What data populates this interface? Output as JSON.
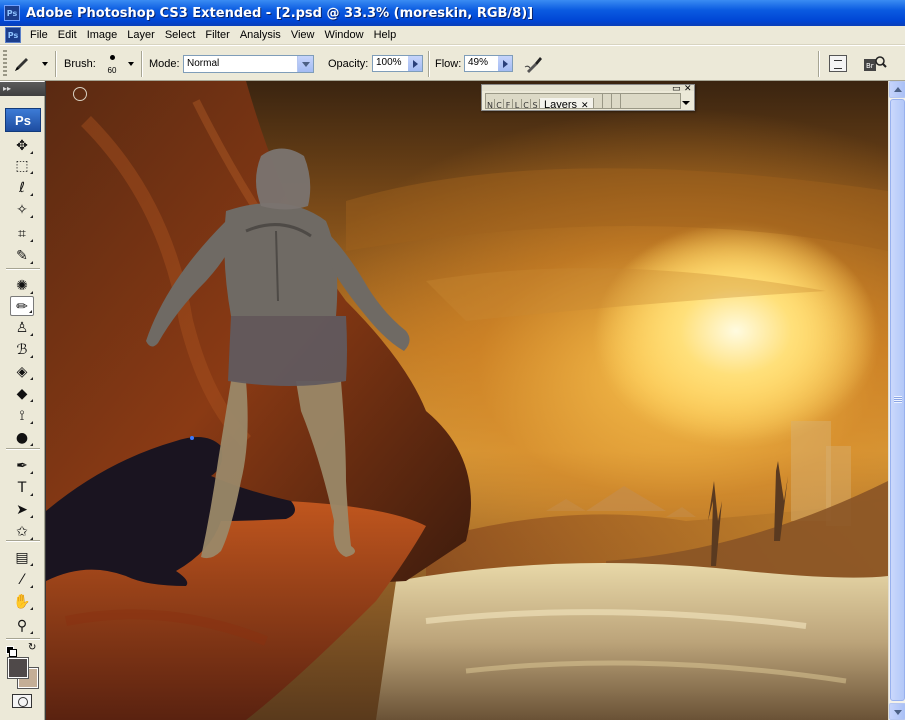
{
  "window": {
    "title": "Adobe Photoshop CS3 Extended - [2.psd @ 33.3% (moreskin, RGB/8)]",
    "app_icon_label": "Ps"
  },
  "menubar": {
    "doc_icon_label": "Ps",
    "items": [
      "File",
      "Edit",
      "Image",
      "Layer",
      "Select",
      "Filter",
      "Analysis",
      "View",
      "Window",
      "Help"
    ]
  },
  "options_bar": {
    "brush_label": "Brush:",
    "brush_size": "60",
    "mode_label": "Mode:",
    "mode_value": "Normal",
    "opacity_label": "Opacity:",
    "opacity_value": "100%",
    "flow_label": "Flow:",
    "flow_value": "49%"
  },
  "toolbox": {
    "logo_label": "Ps",
    "tools": [
      {
        "name": "move-tool-icon",
        "glyph": "✥"
      },
      {
        "name": "marquee-tool-icon",
        "glyph": "⬚"
      },
      {
        "name": "lasso-tool-icon",
        "glyph": "ℓ"
      },
      {
        "name": "magic-wand-tool-icon",
        "glyph": "✧"
      },
      {
        "name": "crop-tool-icon",
        "glyph": "⌗"
      },
      {
        "name": "slice-tool-icon",
        "glyph": "✎"
      },
      {
        "name": "healing-brush-tool-icon",
        "glyph": "✺"
      },
      {
        "name": "brush-tool-icon",
        "glyph": "✏"
      },
      {
        "name": "clone-stamp-tool-icon",
        "glyph": "♙"
      },
      {
        "name": "history-brush-tool-icon",
        "glyph": "ℬ"
      },
      {
        "name": "eraser-tool-icon",
        "glyph": "◈"
      },
      {
        "name": "paint-bucket-tool-icon",
        "glyph": "◆"
      },
      {
        "name": "blur-tool-icon",
        "glyph": "⟟"
      },
      {
        "name": "dodge-tool-icon",
        "glyph": "●"
      },
      {
        "name": "pen-tool-icon",
        "glyph": "✒"
      },
      {
        "name": "type-tool-icon",
        "glyph": "T"
      },
      {
        "name": "path-selection-tool-icon",
        "glyph": "➤"
      },
      {
        "name": "shape-tool-icon",
        "glyph": "✩"
      },
      {
        "name": "notes-tool-icon",
        "glyph": "▤"
      },
      {
        "name": "eyedropper-tool-icon",
        "glyph": "⁄"
      },
      {
        "name": "hand-tool-icon",
        "glyph": "✋"
      },
      {
        "name": "zoom-tool-icon",
        "glyph": "⚲"
      }
    ],
    "selected_tool": "brush-tool-icon",
    "foreground_color": "#4f4949",
    "background_color": "#c4ae96"
  },
  "layers_palette": {
    "collapsed_tabs": [
      "N",
      "C",
      "F",
      "L",
      "C",
      "S"
    ],
    "active_tab": "Layers",
    "trailing_tabs": [
      "",
      ""
    ]
  }
}
